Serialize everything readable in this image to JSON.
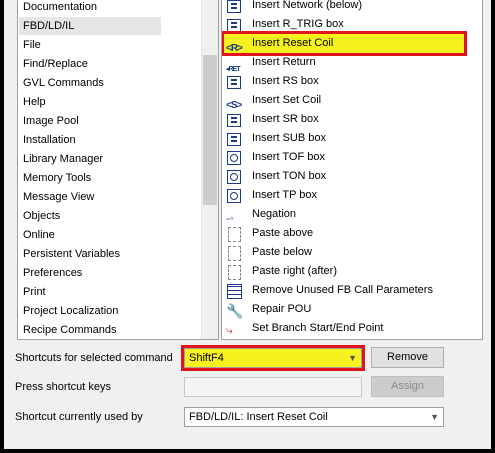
{
  "categories": {
    "items": [
      {
        "label": "Documentation",
        "selected": false
      },
      {
        "label": "FBD/LD/IL",
        "selected": true
      },
      {
        "label": "File",
        "selected": false
      },
      {
        "label": "Find/Replace",
        "selected": false
      },
      {
        "label": "GVL Commands",
        "selected": false
      },
      {
        "label": "Help",
        "selected": false
      },
      {
        "label": "Image Pool",
        "selected": false
      },
      {
        "label": "Installation",
        "selected": false
      },
      {
        "label": "Library Manager",
        "selected": false
      },
      {
        "label": "Memory Tools",
        "selected": false
      },
      {
        "label": "Message View",
        "selected": false
      },
      {
        "label": "Objects",
        "selected": false
      },
      {
        "label": "Online",
        "selected": false
      },
      {
        "label": "Persistent Variables",
        "selected": false
      },
      {
        "label": "Preferences",
        "selected": false
      },
      {
        "label": "Print",
        "selected": false
      },
      {
        "label": "Project Localization",
        "selected": false
      },
      {
        "label": "Recipe Commands",
        "selected": false
      }
    ]
  },
  "commands": {
    "items": [
      {
        "label": "Insert Network (below)",
        "icon": "box-icon",
        "selected": false
      },
      {
        "label": "Insert R_TRIG box",
        "icon": "box-icon",
        "selected": false
      },
      {
        "label": "Insert Reset Coil",
        "icon": "reset-coil-icon",
        "selected": true
      },
      {
        "label": "Insert Return",
        "icon": "return-icon",
        "selected": false
      },
      {
        "label": "Insert RS box",
        "icon": "box-icon",
        "selected": false
      },
      {
        "label": "Insert Set Coil",
        "icon": "set-coil-icon",
        "selected": false
      },
      {
        "label": "Insert SR box",
        "icon": "box-icon",
        "selected": false
      },
      {
        "label": "Insert SUB box",
        "icon": "box-icon",
        "selected": false
      },
      {
        "label": "Insert TOF box",
        "icon": "timer-icon",
        "selected": false
      },
      {
        "label": "Insert TON box",
        "icon": "timer-icon",
        "selected": false
      },
      {
        "label": "Insert TP box",
        "icon": "timer-icon",
        "selected": false
      },
      {
        "label": "Negation",
        "icon": "negation-icon",
        "selected": false
      },
      {
        "label": "Paste above",
        "icon": "blank-icon",
        "selected": false
      },
      {
        "label": "Paste below",
        "icon": "blank-icon",
        "selected": false
      },
      {
        "label": "Paste right (after)",
        "icon": "blank-icon",
        "selected": false
      },
      {
        "label": "Remove Unused FB Call Parameters",
        "icon": "grid-icon",
        "selected": false
      },
      {
        "label": "Repair POU",
        "icon": "wrench-icon",
        "selected": false
      },
      {
        "label": "Set Branch Start/End Point",
        "icon": "branch-icon",
        "selected": false
      }
    ]
  },
  "form": {
    "shortcuts_label": "Shortcuts for selected command",
    "shortcut_value": "ShiftF4",
    "remove_label": "Remove",
    "press_keys_label": "Press shortcut keys",
    "press_keys_value": "",
    "assign_label": "Assign",
    "currently_used_label": "Shortcut currently used by",
    "currently_used_value": "FBD/LD/IL: Insert Reset Coil"
  },
  "colors": {
    "highlight_fill": "#f7f21d",
    "highlight_border": "#e0151b"
  }
}
